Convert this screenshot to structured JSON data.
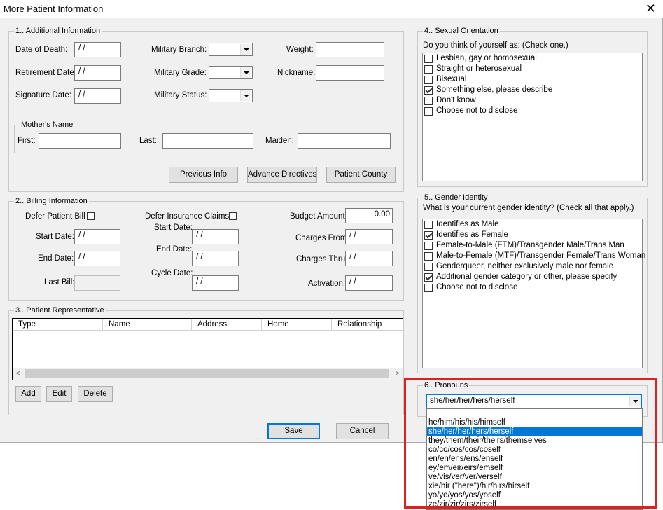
{
  "window": {
    "title": "More Patient Information",
    "close": "✕"
  },
  "s1": {
    "legend": "1.. Additional Information",
    "date_of_death_label": "Date of Death:",
    "date_of_death": " / /",
    "retirement_label": "Retirement Date:",
    "retirement": " / /",
    "signature_label": "Signature Date:",
    "signature": " / /",
    "mil_branch_label": "Military Branch:",
    "mil_grade_label": "Military Grade:",
    "mil_status_label": "Military Status:",
    "weight_label": "Weight:",
    "weight": "",
    "nickname_label": "Nickname:",
    "nickname": "",
    "mother_legend": "Mother's Name",
    "first_label": "First:",
    "first": "",
    "last_label": "Last:",
    "last": "",
    "maiden_label": "Maiden:",
    "maiden": "",
    "btn_previous": "Previous Info",
    "btn_advance": "Advance Directives",
    "btn_county": "Patient County"
  },
  "s2": {
    "legend": "2.. Billing Information",
    "defer_bill_label": "Defer Patient Bill",
    "defer_ins_label": "Defer Insurance Claims",
    "start_date_label": "Start Date:",
    "start_date": " / /",
    "end_date_label": "End Date:",
    "end_date": " / /",
    "last_bill_label": "Last Bill:",
    "last_bill": "",
    "ins_start_label": "Start Date:",
    "ins_start": " / /",
    "ins_end_label": "End Date:",
    "ins_end": " / /",
    "cycle_label": "Cycle Date:",
    "cycle": " / /",
    "budget_label": "Budget Amount:",
    "budget": "0.00",
    "charges_from_label": "Charges From:",
    "charges_from": " / /",
    "charges_thru_label": "Charges Thru:",
    "charges_thru": " / /",
    "activation_label": "Activation:",
    "activation": " / /"
  },
  "s3": {
    "legend": "3.. Patient Representative",
    "columns": [
      "Type",
      "Name",
      "Address",
      "Home",
      "Relationship"
    ],
    "btn_add": "Add",
    "btn_edit": "Edit",
    "btn_delete": "Delete",
    "scroll_left": "<",
    "scroll_right": ">"
  },
  "s4": {
    "legend": "4.. Sexual Orientation",
    "question": "Do you think of yourself as:  (Check one.)",
    "options": [
      {
        "label": "Lesbian, gay or homosexual",
        "checked": false
      },
      {
        "label": "Straight or heterosexual",
        "checked": false
      },
      {
        "label": "Bisexual",
        "checked": false
      },
      {
        "label": "Something else, please describe",
        "checked": true
      },
      {
        "label": "Don't know",
        "checked": false
      },
      {
        "label": "Choose not to disclose",
        "checked": false
      }
    ]
  },
  "s5": {
    "legend": "5.. Gender Identity",
    "question": "What is your current gender identity? (Check all that apply.)",
    "options": [
      {
        "label": "Identifies as Male",
        "checked": false
      },
      {
        "label": "Identifies as Female",
        "checked": true
      },
      {
        "label": "Female-to-Male (FTM)/Transgender Male/Trans Man",
        "checked": false
      },
      {
        "label": "Male-to-Female (MTF)/Transgender Female/Trans Woman",
        "checked": false
      },
      {
        "label": "Genderqueer, neither exclusively male nor female",
        "checked": false
      },
      {
        "label": "Additional gender category or other, please specify",
        "checked": true
      },
      {
        "label": "Choose not to disclose",
        "checked": false
      }
    ]
  },
  "s6": {
    "legend": "6.. Pronouns",
    "selected": "she/her/her/hers/herself",
    "options": [
      "",
      "he/him/his/his/himself",
      "she/her/her/hers/herself",
      "they/them/their/theirs/themselves",
      "co/co/cos/cos/coself",
      "en/en/ens/ens/enself",
      "ey/em/eir/eirs/emself",
      "ve/vis/ver/ver/verself",
      "xie/hir (\"here\")/hir/hirs/hirself",
      "yo/yo/yos/yos/yoself",
      "ze/zir/zir/zirs/zirself"
    ],
    "highlighted_index": 2
  },
  "footer": {
    "save": "Save",
    "cancel": "Cancel"
  },
  "colors": {
    "selection": "#0078d7",
    "annotation_box": "#e02020",
    "dialog_bg": "#f0f0f0"
  }
}
